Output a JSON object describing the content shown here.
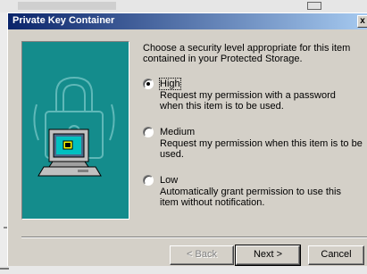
{
  "window": {
    "title": "Private Key Container",
    "close_glyph": "x"
  },
  "intro_text": "Choose a security level appropriate for this item contained in your Protected Storage.",
  "options": [
    {
      "label": "High",
      "description": "Request my permission with a password when this item is to be used.",
      "selected": true
    },
    {
      "label": "Medium",
      "description": "Request my permission when this item is to be used.",
      "selected": false
    },
    {
      "label": "Low",
      "description": "Automatically grant permission to use this item without notification.",
      "selected": false
    }
  ],
  "buttons": {
    "back": "< Back",
    "next": "Next >",
    "cancel": "Cancel"
  },
  "colors": {
    "art_background": "#148c8c",
    "titlebar_start": "#0a246a",
    "titlebar_end": "#a6caf0"
  },
  "icons": [
    "padlock-icon",
    "computer-icon",
    "close-icon"
  ]
}
